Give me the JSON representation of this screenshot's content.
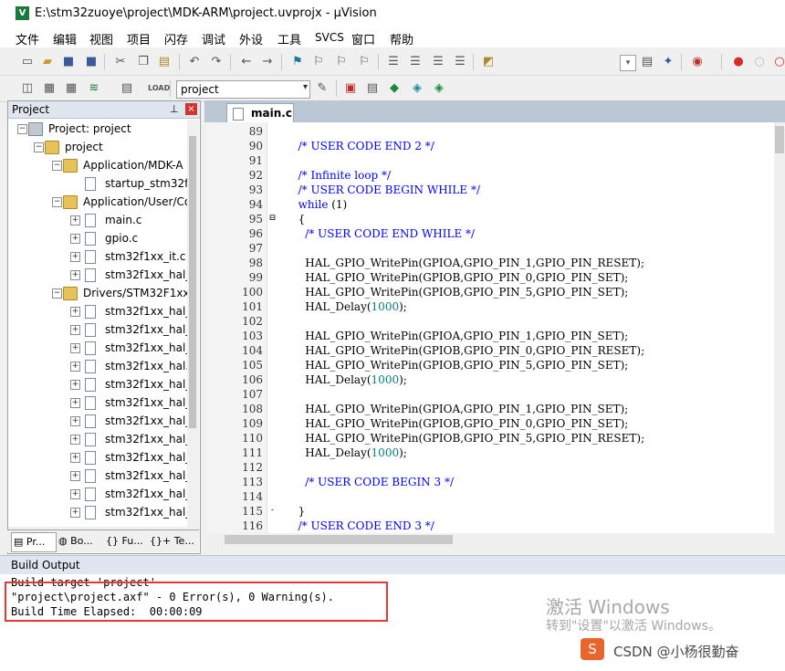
{
  "window": {
    "title": "E:\\stm32zuoye\\project\\MDK-ARM\\project.uvprojx - µVision",
    "logo": "V"
  },
  "menu": [
    "文件",
    "编辑",
    "视图",
    "项目",
    "闪存",
    "调试",
    "外设",
    "工具",
    "SVCS",
    "窗口",
    "帮助"
  ],
  "toolbar2": {
    "target": "project"
  },
  "project_panel": {
    "title": "Project",
    "tree": [
      {
        "label": "Project: project",
        "type": "root"
      },
      {
        "label": "project",
        "type": "folder"
      },
      {
        "label": "Application/MDK-A",
        "type": "folder"
      },
      {
        "label": "startup_stm32f1(",
        "type": "file"
      },
      {
        "label": "Application/User/Co",
        "type": "folder"
      },
      {
        "label": "main.c",
        "type": "file"
      },
      {
        "label": "gpio.c",
        "type": "file"
      },
      {
        "label": "stm32f1xx_it.c",
        "type": "file"
      },
      {
        "label": "stm32f1xx_hal_r",
        "type": "file"
      },
      {
        "label": "Drivers/STM32F1xx_",
        "type": "folder"
      },
      {
        "label": "stm32f1xx_hal_g",
        "type": "file"
      },
      {
        "label": "stm32f1xx_hal_t",
        "type": "file"
      },
      {
        "label": "stm32f1xx_hal_t",
        "type": "file"
      },
      {
        "label": "stm32f1xx_hal.c",
        "type": "file"
      },
      {
        "label": "stm32f1xx_hal_r",
        "type": "file"
      },
      {
        "label": "stm32f1xx_hal_r",
        "type": "file"
      },
      {
        "label": "stm32f1xx_hal_g",
        "type": "file"
      },
      {
        "label": "stm32f1xx_hal_c",
        "type": "file"
      },
      {
        "label": "stm32f1xx_hal_c",
        "type": "file"
      },
      {
        "label": "stm32f1xx_hal_p",
        "type": "file"
      },
      {
        "label": "stm32f1xx_hal_f",
        "type": "file"
      },
      {
        "label": "stm32f1xx_hal_f",
        "type": "file"
      }
    ],
    "tabs": [
      "Pr...",
      "Bo...",
      "{} Fu...",
      "{}+ Te..."
    ]
  },
  "editor": {
    "tab": "main.c",
    "lines": [
      {
        "n": "89",
        "text": ""
      },
      {
        "n": "90",
        "text": "  /* USER CODE END 2 */"
      },
      {
        "n": "91",
        "text": ""
      },
      {
        "n": "92",
        "text": "  /* Infinite loop */"
      },
      {
        "n": "93",
        "text": "  /* USER CODE BEGIN WHILE */"
      },
      {
        "n": "94",
        "text": "  while (1)"
      },
      {
        "n": "95",
        "text": "  {"
      },
      {
        "n": "96",
        "text": "    /* USER CODE END WHILE */"
      },
      {
        "n": "97",
        "text": ""
      },
      {
        "n": "98",
        "text": "    HAL_GPIO_WritePin(GPIOA,GPIO_PIN_1,GPIO_PIN_RESET);"
      },
      {
        "n": "99",
        "text": "    HAL_GPIO_WritePin(GPIOB,GPIO_PIN_0,GPIO_PIN_SET);"
      },
      {
        "n": "100",
        "text": "    HAL_GPIO_WritePin(GPIOB,GPIO_PIN_5,GPIO_PIN_SET);"
      },
      {
        "n": "101",
        "text": "    HAL_Delay(1000);"
      },
      {
        "n": "102",
        "text": ""
      },
      {
        "n": "103",
        "text": "    HAL_GPIO_WritePin(GPIOA,GPIO_PIN_1,GPIO_PIN_SET);"
      },
      {
        "n": "104",
        "text": "    HAL_GPIO_WritePin(GPIOB,GPIO_PIN_0,GPIO_PIN_RESET);"
      },
      {
        "n": "105",
        "text": "    HAL_GPIO_WritePin(GPIOB,GPIO_PIN_5,GPIO_PIN_SET);"
      },
      {
        "n": "106",
        "text": "    HAL_Delay(1000);"
      },
      {
        "n": "107",
        "text": ""
      },
      {
        "n": "108",
        "text": "    HAL_GPIO_WritePin(GPIOA,GPIO_PIN_1,GPIO_PIN_SET);"
      },
      {
        "n": "109",
        "text": "    HAL_GPIO_WritePin(GPIOB,GPIO_PIN_0,GPIO_PIN_SET);"
      },
      {
        "n": "110",
        "text": "    HAL_GPIO_WritePin(GPIOB,GPIO_PIN_5,GPIO_PIN_RESET);"
      },
      {
        "n": "111",
        "text": "    HAL_Delay(1000);"
      },
      {
        "n": "112",
        "text": ""
      },
      {
        "n": "113",
        "text": "    /* USER CODE BEGIN 3 */"
      },
      {
        "n": "114",
        "text": ""
      },
      {
        "n": "115",
        "text": "  }"
      },
      {
        "n": "116",
        "text": "  /* USER CODE END 3 */"
      }
    ]
  },
  "build_output": {
    "title": "Build Output",
    "lines": [
      "Build target 'project'",
      "\"project\\project.axf\" - 0 Error(s), 0 Warning(s).",
      "Build Time Elapsed:  00:00:09"
    ]
  },
  "overlay": {
    "activate_title": "激活 Windows",
    "activate_sub": "转到\"设置\"以激活 Windows。",
    "csdn": "CSDN @小杨很勤奋"
  }
}
